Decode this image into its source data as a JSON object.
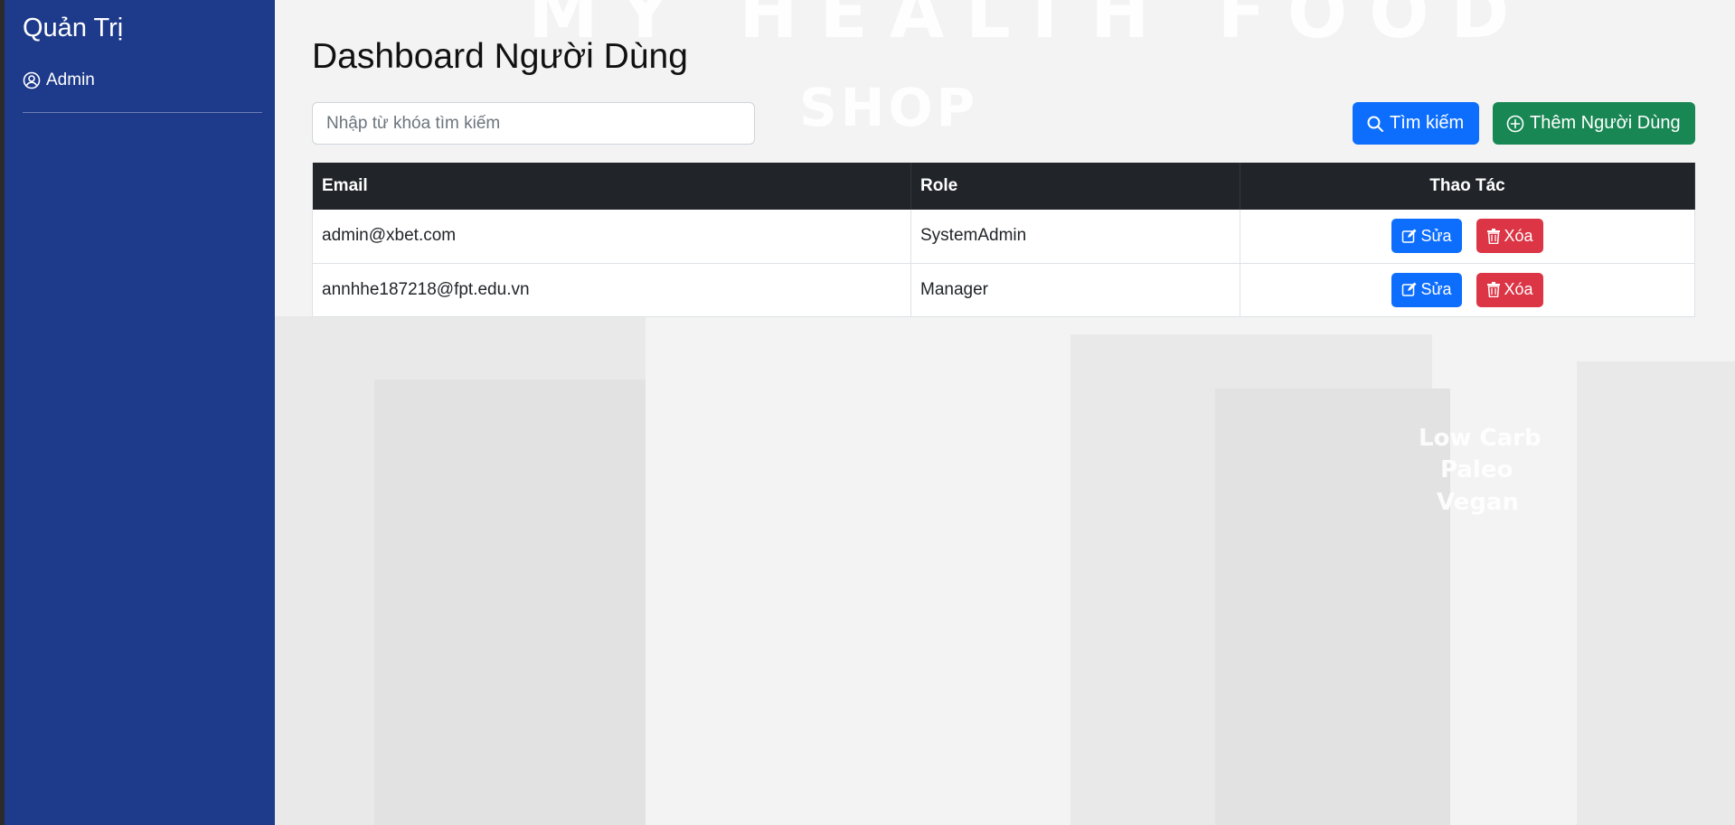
{
  "sidebar": {
    "brand": "Quản Trị",
    "items": [
      {
        "label": "Admin",
        "icon": "user-circle-icon"
      }
    ]
  },
  "main": {
    "title": "Dashboard Người Dùng",
    "search": {
      "placeholder": "Nhập từ khóa tìm kiếm",
      "value": ""
    },
    "search_button": "Tìm kiếm",
    "add_button": "Thêm Người Dùng"
  },
  "table": {
    "headers": [
      "Email",
      "Role",
      "Thao Tác"
    ],
    "rows": [
      {
        "email": "admin@xbet.com",
        "role": "SystemAdmin",
        "edit": "Sửa",
        "delete": "Xóa"
      },
      {
        "email": "annhhe187218@fpt.edu.vn",
        "role": "Manager",
        "edit": "Sửa",
        "delete": "Xóa"
      }
    ]
  },
  "background_text": {
    "top": "MY HEALTH FOOD",
    "shop": "SHOP",
    "sign": [
      "Low Carb",
      "Paleo",
      "Vegan"
    ]
  },
  "colors": {
    "sidebar": "#1e3a8a",
    "primary": "#0d6efd",
    "success": "#198754",
    "danger": "#dc3545",
    "table_header": "#212529"
  }
}
